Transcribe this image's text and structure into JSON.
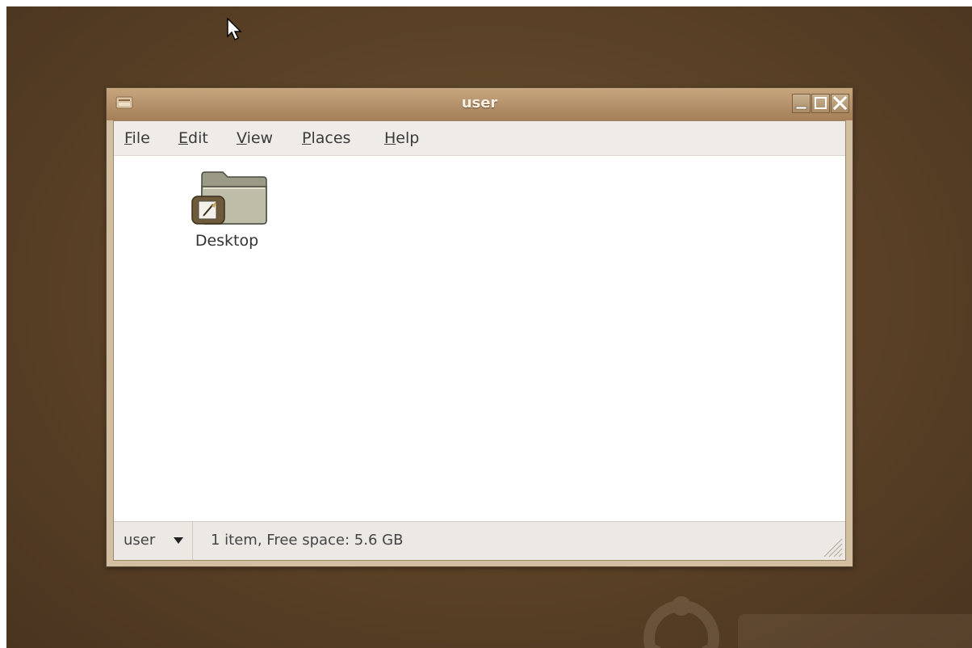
{
  "window": {
    "title": "user",
    "controls": [
      "minimize-icon",
      "maximize-icon",
      "close-icon"
    ]
  },
  "menubar": {
    "file": {
      "mnemonic": "F",
      "rest": "ile"
    },
    "edit": {
      "mnemonic": "E",
      "rest": "dit"
    },
    "view": {
      "mnemonic": "V",
      "rest": "iew"
    },
    "places": {
      "mnemonic": "P",
      "rest": "laces"
    },
    "help": {
      "mnemonic": "H",
      "rest": "elp"
    }
  },
  "content": {
    "items": [
      {
        "label": "Desktop",
        "icon": "desktop-folder-icon"
      }
    ]
  },
  "statusbar": {
    "location": "user",
    "status": "1 item, Free space: 5.6 GB"
  },
  "colors": {
    "desktop_background": "#5a4126",
    "titlebar": "#b08a61",
    "title_text": "#f7efe3"
  }
}
